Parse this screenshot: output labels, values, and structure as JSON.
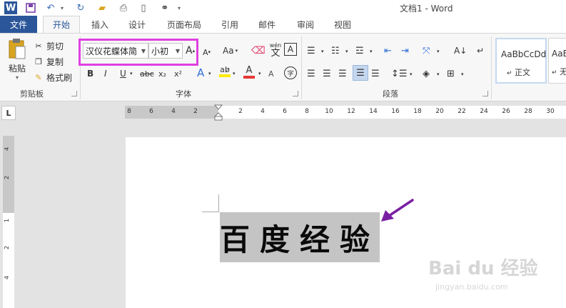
{
  "window": {
    "title": "文档1 - Word"
  },
  "tabs": [
    {
      "label": "文件"
    },
    {
      "label": "开始"
    },
    {
      "label": "插入"
    },
    {
      "label": "设计"
    },
    {
      "label": "页面布局"
    },
    {
      "label": "引用"
    },
    {
      "label": "邮件"
    },
    {
      "label": "审阅"
    },
    {
      "label": "视图"
    }
  ],
  "clipboard": {
    "paste_label": "粘贴",
    "cut_label": "剪切",
    "copy_label": "复制",
    "format_painter_label": "格式刷",
    "group_label": "剪贴板"
  },
  "font": {
    "family_value": "汉仪花蝶体简",
    "size_value": "小初",
    "group_label": "字体",
    "change_case_label": "Aa",
    "phonetic_label": "wén",
    "phonetic_char": "文",
    "border_char": "A",
    "bold": "B",
    "italic": "I",
    "underline": "U",
    "strikethrough": "abc",
    "subscript": "x₂",
    "superscript": "x²",
    "enclose_char": "字"
  },
  "paragraph": {
    "group_label": "段落"
  },
  "styles": [
    {
      "preview": "AaBbCcDd",
      "name": "正文"
    },
    {
      "preview": "AaBb",
      "name": "无"
    }
  ],
  "ruler": {
    "tab_selector": "L",
    "numbers": [
      "8",
      "6",
      "4",
      "2",
      "2",
      "4",
      "6",
      "8",
      "10",
      "12",
      "14",
      "16",
      "18",
      "20",
      "22",
      "24",
      "26",
      "28",
      "30"
    ],
    "vertical_numbers": [
      "4",
      "2",
      "1",
      "2",
      "4"
    ]
  },
  "document": {
    "text": "百度经验"
  },
  "watermark": {
    "brand": "Bai du 经验",
    "url": "jingyan.baidu.com"
  },
  "colors": {
    "accent": "#2b579a",
    "highlight_box": "#e040e0",
    "arrow": "#7b1fa2",
    "text_highlight": "#c4c4c4",
    "font_color": "#e53935",
    "highlighter": "#ffeb00"
  }
}
